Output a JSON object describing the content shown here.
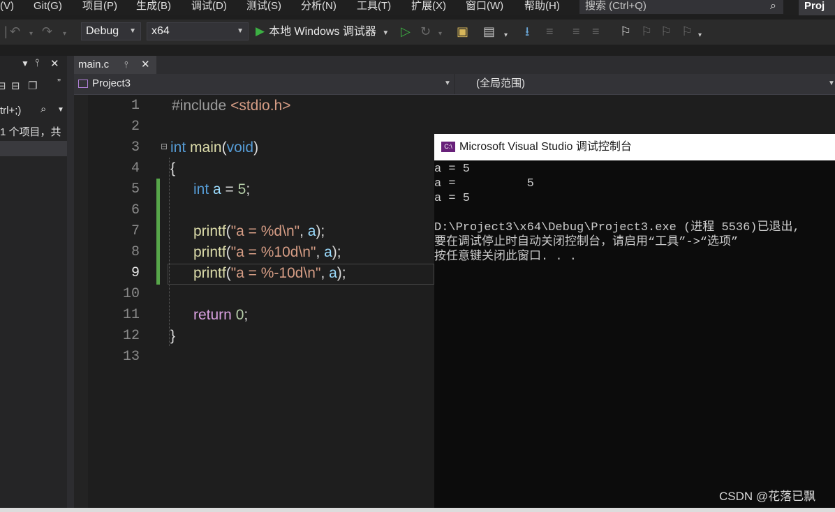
{
  "menu": {
    "items": [
      "(V)",
      "Git(G)",
      "项目(P)",
      "生成(B)",
      "调试(D)",
      "测试(S)",
      "分析(N)",
      "工具(T)",
      "扩展(X)",
      "窗口(W)",
      "帮助(H)"
    ],
    "search_placeholder": "搜索 (Ctrl+Q)",
    "project_tab": "Proj"
  },
  "toolbar": {
    "config": "Debug",
    "platform": "x64",
    "run_label": "本地 Windows 调试器"
  },
  "left_panel": {
    "search_hint": "trl+;)",
    "summary": "1 个项目，共"
  },
  "editor": {
    "tab_title": "main.c",
    "nav_project": "Project3",
    "nav_scope": "(全局范围)",
    "line_numbers": [
      "1",
      "2",
      "3",
      "4",
      "5",
      "6",
      "7",
      "8",
      "9",
      "10",
      "11",
      "12",
      "13"
    ],
    "current_line": "9",
    "code": {
      "l1_pp": "#include",
      "l1_hdr": "<stdio.h>",
      "l3_kw": "int",
      "l3_fn": "main",
      "l3_open": "(",
      "l3_void": "void",
      "l3_close": ")",
      "l4": "{",
      "l5_kw": "int",
      "l5_var": "a",
      "l5_eq": " = ",
      "l5_num": "5",
      "l5_end": ";",
      "l7_fn": "printf",
      "l7_str": "\"a = %d\\n\"",
      "l8_fn": "printf",
      "l8_str": "\"a = %10d\\n\"",
      "l9_fn": "printf",
      "l9_str": "\"a = %-10d\\n\"",
      "comma": ", ",
      "arg": "a",
      "call_end": ");",
      "open_paren": "(",
      "l11_kw": "return",
      "l11_num": "0",
      "l11_end": ";",
      "l12": "}"
    }
  },
  "console": {
    "title": "Microsoft Visual Studio 调试控制台",
    "icon_text": "C:\\",
    "lines": [
      "a = 5",
      "a =          5",
      "a = 5",
      "",
      "D:\\Project3\\x64\\Debug\\Project3.exe (进程 5536)已退出,",
      "要在调试停止时自动关闭控制台，请启用“工具”->“选项”",
      "按任意键关闭此窗口. . ."
    ],
    "watermark": "CSDN @花落已飘"
  }
}
